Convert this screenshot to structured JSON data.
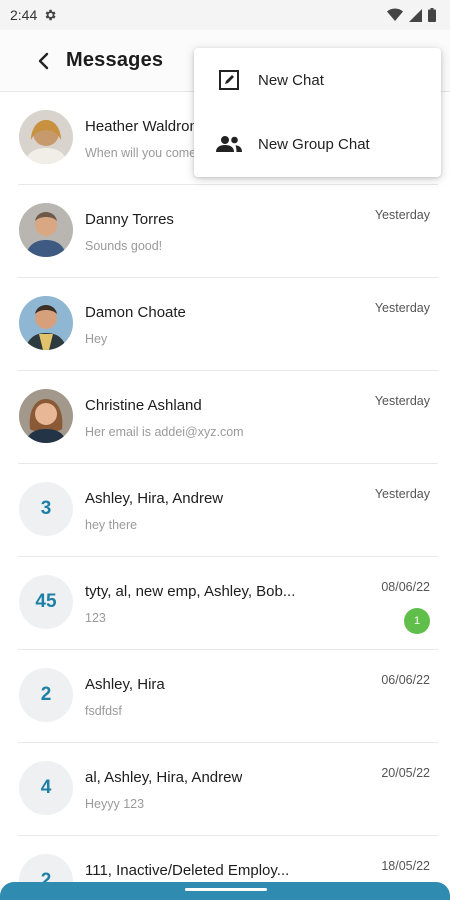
{
  "status": {
    "time": "2:44"
  },
  "header": {
    "title": "Messages"
  },
  "menu": {
    "items": [
      {
        "label": "New Chat"
      },
      {
        "label": "New Group Chat"
      }
    ]
  },
  "conversations": [
    {
      "name": "Heather Waldron",
      "preview": "When will you come",
      "date": "",
      "avatar": "photo",
      "count": ""
    },
    {
      "name": "Danny Torres",
      "preview": "Sounds good!",
      "date": "Yesterday",
      "avatar": "photo",
      "count": ""
    },
    {
      "name": "Damon  Choate",
      "preview": "Hey",
      "date": "Yesterday",
      "avatar": "photo",
      "count": ""
    },
    {
      "name": "Christine Ashland",
      "preview": "Her email is addei@xyz.com",
      "date": "Yesterday",
      "avatar": "photo",
      "count": ""
    },
    {
      "name": "Ashley, Hira, Andrew",
      "preview": "hey there",
      "date": "Yesterday",
      "avatar": "number",
      "count": "3"
    },
    {
      "name": "tyty, al, new emp, Ashley, Bob...",
      "preview": "123",
      "date": "08/06/22",
      "avatar": "number",
      "count": "45",
      "unread": "1"
    },
    {
      "name": "Ashley, Hira",
      "preview": "fsdfdsf",
      "date": "06/06/22",
      "avatar": "number",
      "count": "2"
    },
    {
      "name": "al, Ashley, Hira, Andrew",
      "preview": "Heyyy 123",
      "date": "20/05/22",
      "avatar": "number",
      "count": "4"
    },
    {
      "name": "111, Inactive/Deleted Employ...",
      "preview": "",
      "date": "18/05/22",
      "avatar": "number",
      "count": "2"
    }
  ],
  "colors": {
    "accent": "#1e7fa7",
    "badge": "#5fbf4a",
    "bottom_bar": "#2f8bb0"
  }
}
